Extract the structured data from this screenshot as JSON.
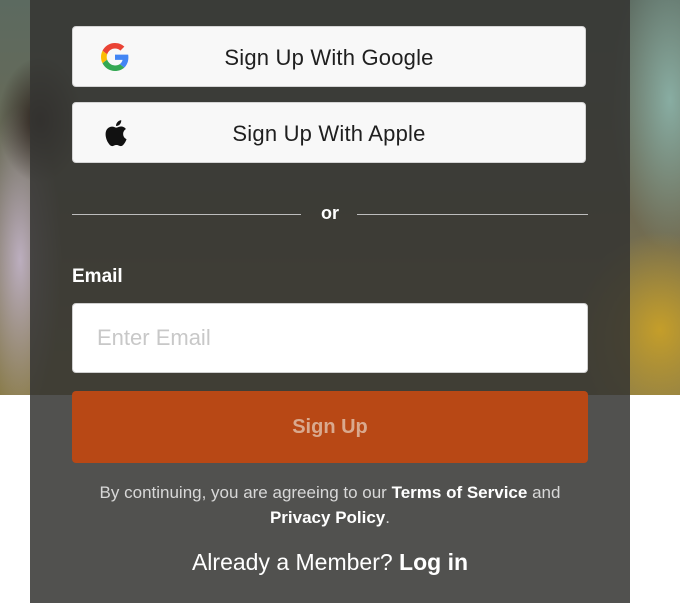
{
  "social": {
    "google_label": "Sign Up With Google",
    "apple_label": "Sign Up With Apple"
  },
  "divider": {
    "text": "or"
  },
  "email": {
    "label": "Email",
    "placeholder": "Enter Email",
    "value": ""
  },
  "signup": {
    "label": "Sign Up"
  },
  "legal": {
    "prefix": "By continuing, you are agreeing to our ",
    "terms_link": "Terms of Service",
    "conjunction": " and",
    "privacy_link": "Privacy Policy",
    "suffix": "."
  },
  "member": {
    "prompt": "Already a Member? ",
    "login_link": "Log in"
  },
  "colors": {
    "panel": "#343432",
    "signup_button": "#b84815",
    "divider": "#bdbdbd"
  },
  "icons": [
    "google-icon",
    "apple-icon"
  ]
}
